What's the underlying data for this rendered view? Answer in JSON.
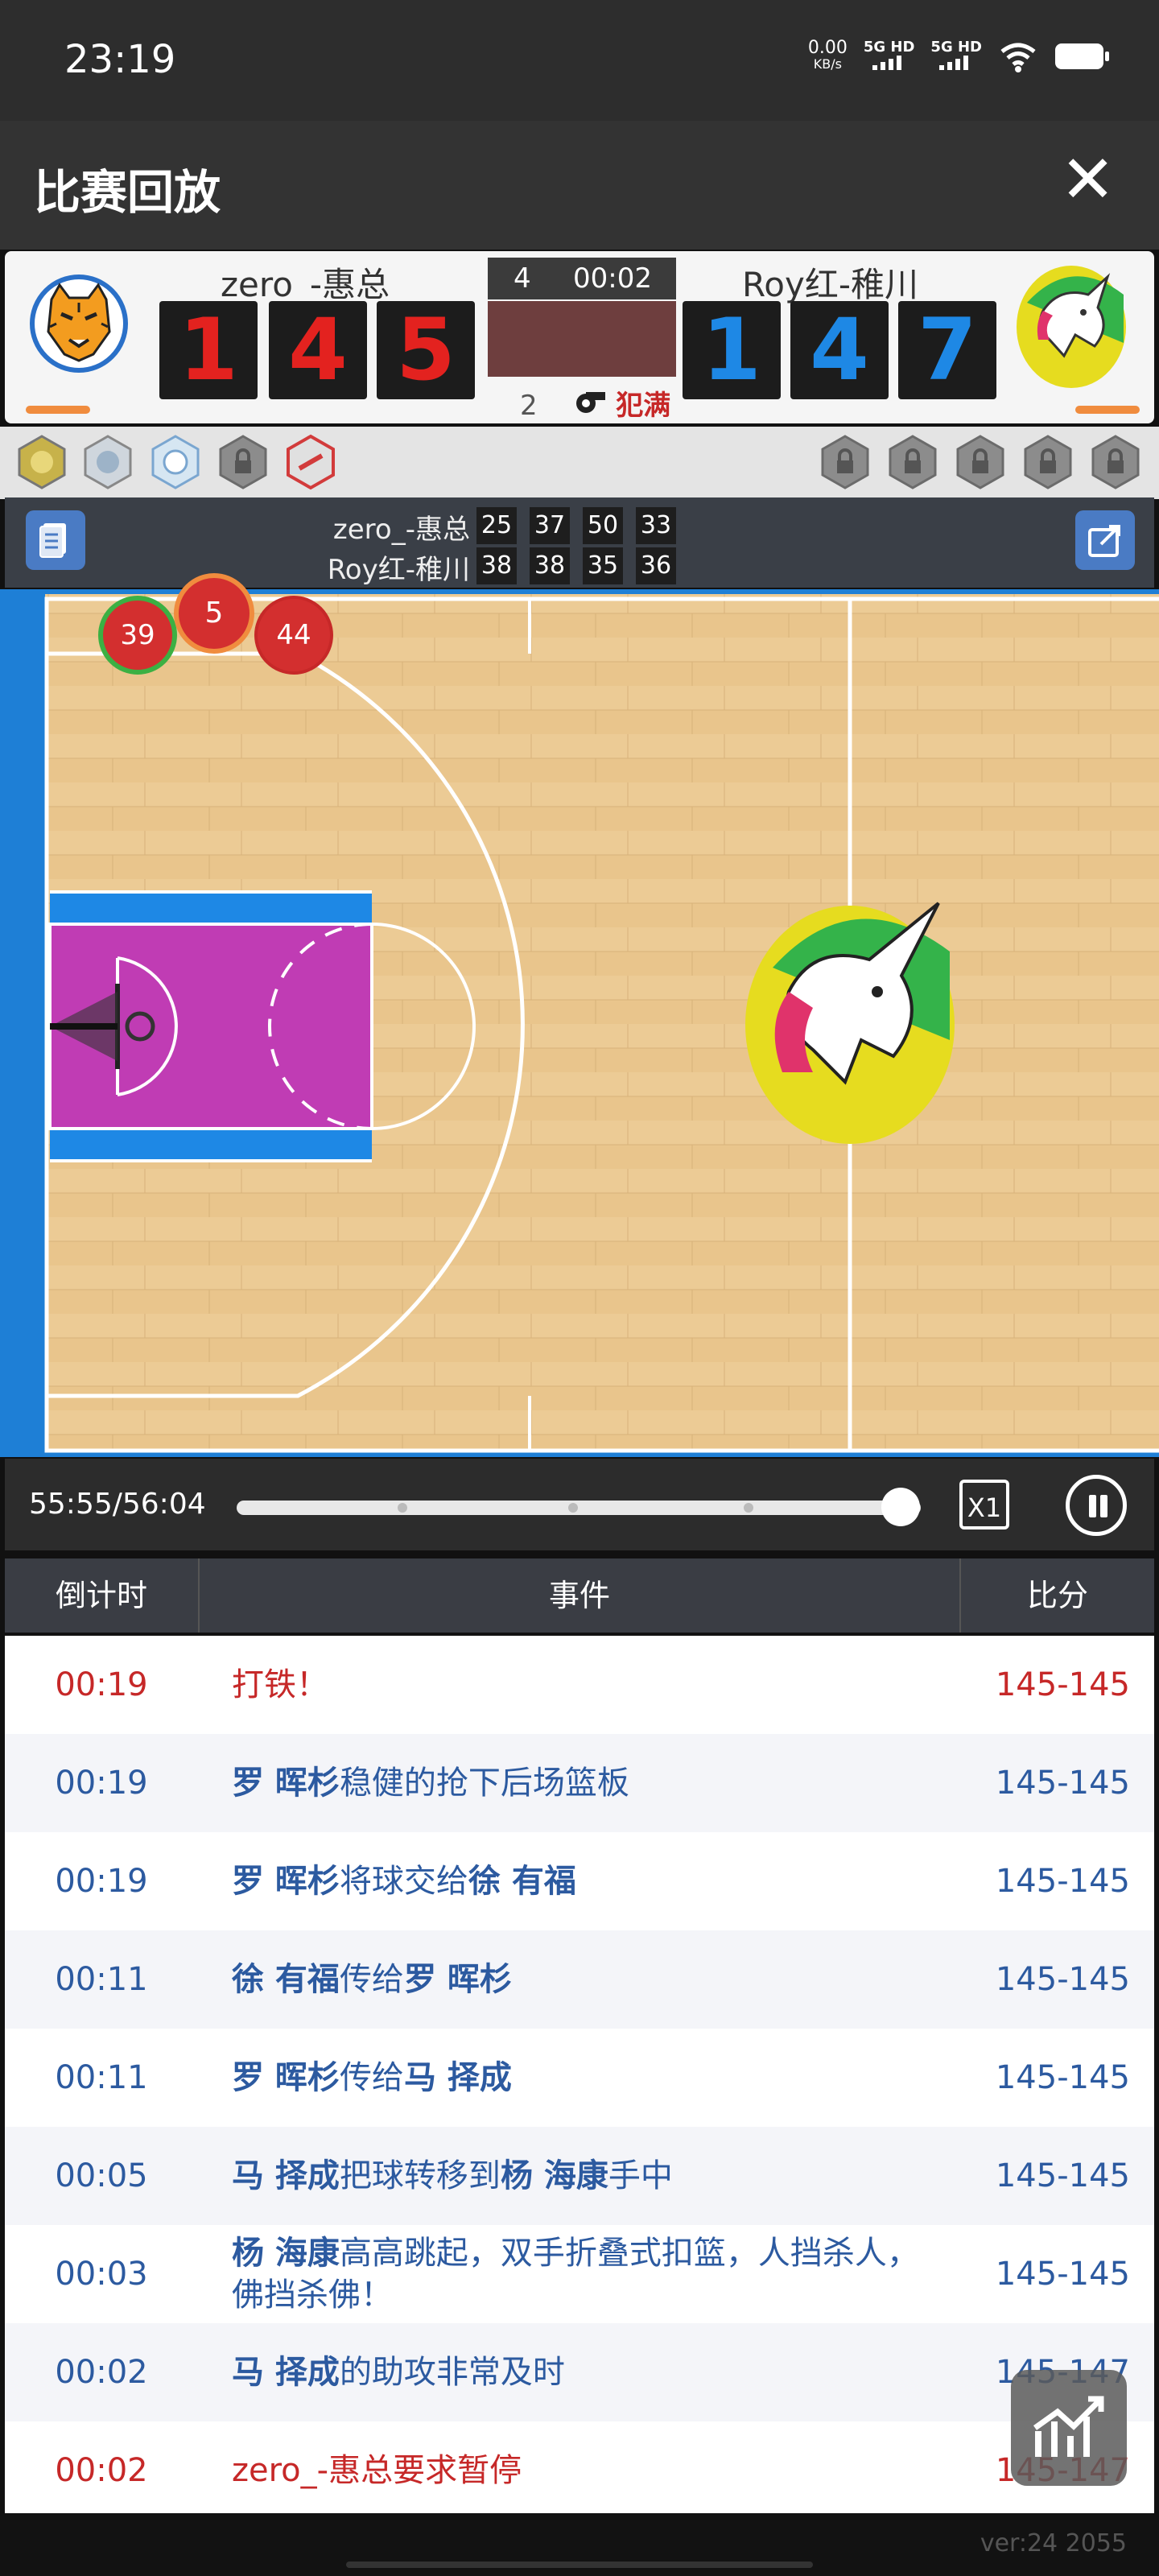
{
  "status_bar": {
    "time": "23:19",
    "net_speed": "0.00",
    "net_unit": "KB/s",
    "sig1": "5G HD",
    "sig2": "5G HD"
  },
  "header": {
    "title": "比赛回放",
    "close_label": "✕"
  },
  "scoreboard": {
    "home": {
      "name": "zero_-惠总",
      "digits": [
        "1",
        "4",
        "5"
      ]
    },
    "away": {
      "name": "Roy红-稚川",
      "digits": [
        "1",
        "4",
        "7"
      ]
    },
    "quarter": "4",
    "clock": "00:02",
    "fouls": "2",
    "bonus_label": "犯满"
  },
  "quarter_scores": {
    "home": {
      "name": "zero_-惠总",
      "q": [
        "25",
        "37",
        "50",
        "33"
      ]
    },
    "away": {
      "name": "Roy红-稚川",
      "q": [
        "38",
        "38",
        "35",
        "36"
      ]
    }
  },
  "court": {
    "players": [
      "39",
      "5",
      "44"
    ],
    "paint_color": "#c03cb4"
  },
  "playback": {
    "elapsed": "55:55/56:04",
    "progress": 0.97,
    "speed": "X1"
  },
  "table": {
    "headers": [
      "倒计时",
      "事件",
      "比分"
    ],
    "rows": [
      {
        "time": "00:19",
        "parts": [
          [
            "打铁！",
            false
          ]
        ],
        "score": "145-145",
        "color": "red"
      },
      {
        "time": "00:19",
        "parts": [
          [
            "罗 晖杉",
            true
          ],
          [
            "稳健的抢下后场篮板",
            false
          ]
        ],
        "score": "145-145",
        "color": "blue"
      },
      {
        "time": "00:19",
        "parts": [
          [
            "罗 晖杉",
            true
          ],
          [
            "将球交给",
            false
          ],
          [
            "徐 有福",
            true
          ]
        ],
        "score": "145-145",
        "color": "blue"
      },
      {
        "time": "00:11",
        "parts": [
          [
            "徐 有福",
            true
          ],
          [
            "传给",
            false
          ],
          [
            "罗 晖杉",
            true
          ]
        ],
        "score": "145-145",
        "color": "blue"
      },
      {
        "time": "00:11",
        "parts": [
          [
            "罗 晖杉",
            true
          ],
          [
            "传给",
            false
          ],
          [
            "马 择成",
            true
          ]
        ],
        "score": "145-145",
        "color": "blue"
      },
      {
        "time": "00:05",
        "parts": [
          [
            "马 择成",
            true
          ],
          [
            "把球转移到",
            false
          ],
          [
            "杨 海康",
            true
          ],
          [
            "手中",
            false
          ]
        ],
        "score": "145-145",
        "color": "blue"
      },
      {
        "time": "00:03",
        "parts": [
          [
            "杨 海康",
            true
          ],
          [
            "高高跳起，双手折叠式扣篮，人挡杀人，佛挡杀佛！",
            false
          ]
        ],
        "score": "145-145",
        "color": "blue"
      },
      {
        "time": "00:02",
        "parts": [
          [
            "马 择成",
            true
          ],
          [
            "的助攻非常及时",
            false
          ]
        ],
        "score": "145-147",
        "color": "blue"
      },
      {
        "time": "00:02",
        "parts": [
          [
            "zero_-惠总要求暂停",
            false
          ]
        ],
        "score": "145-147",
        "color": "red"
      }
    ]
  },
  "footer": {
    "version": "ver:24   2055"
  }
}
